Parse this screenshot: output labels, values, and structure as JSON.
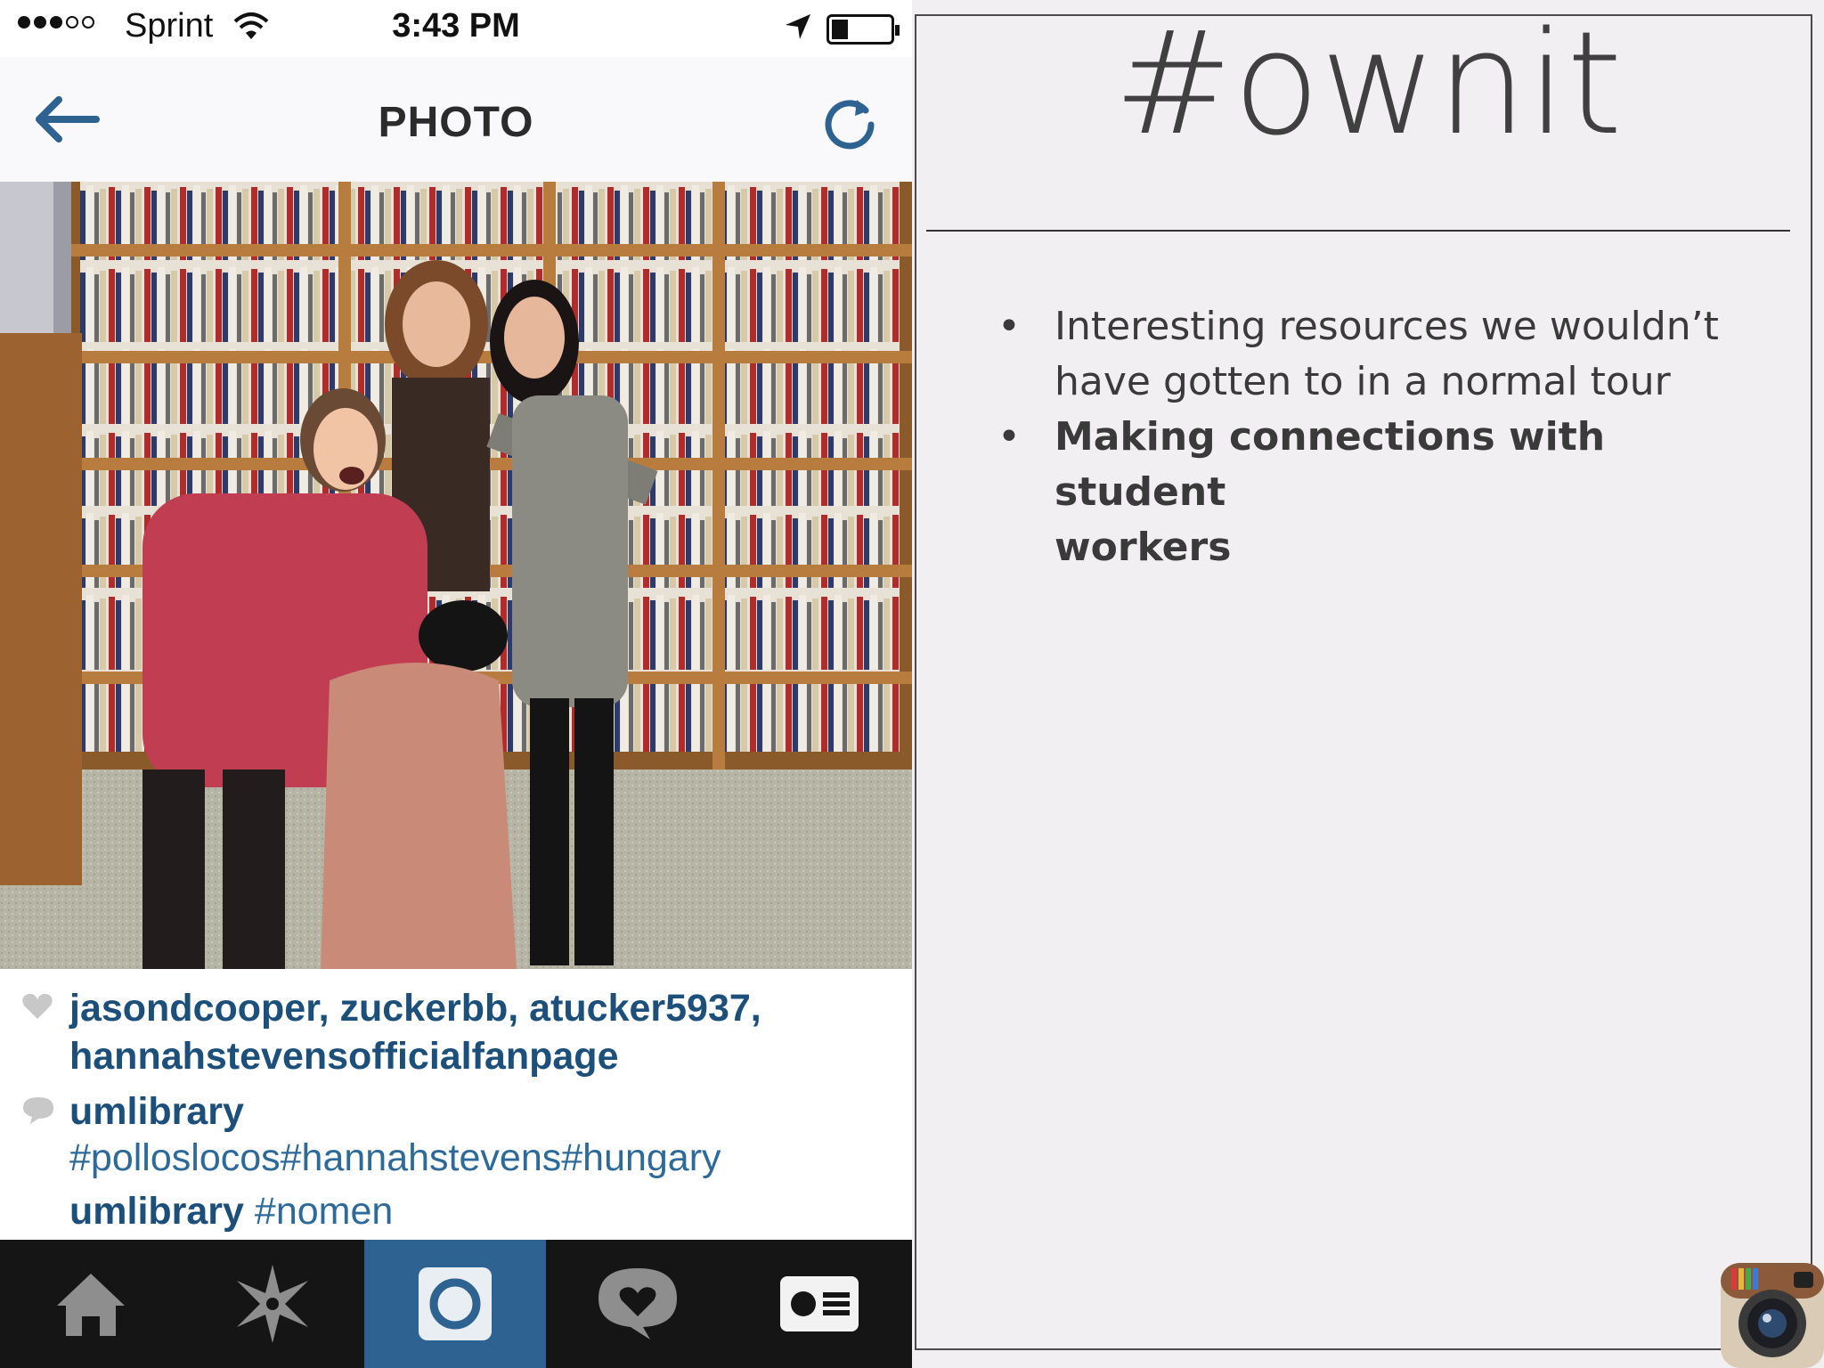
{
  "status_bar": {
    "carrier": "Sprint",
    "time": "3:43 PM"
  },
  "nav": {
    "title": "PHOTO",
    "back_icon": "arrow-left-icon",
    "refresh_icon": "refresh-icon"
  },
  "photo": {
    "alt": "Four students posing in front of library bookshelves"
  },
  "caption": {
    "likes": [
      "jasondcooper,",
      "zuckerbb,",
      "atucker5937,",
      "hannahstevensofficialfanpage"
    ],
    "comments": [
      {
        "user": "umlibrary",
        "text": "#polloslocos#hannahstevens#hungary"
      },
      {
        "user": "umlibrary",
        "text": "#nomen"
      }
    ]
  },
  "tab_bar": {
    "tabs": [
      "home-icon",
      "explore-icon",
      "camera-icon",
      "activity-icon",
      "profile-icon"
    ],
    "active_index": 2
  },
  "slide": {
    "title": "#ownit",
    "bullets": [
      {
        "line1": "Interesting resources we wouldn’t",
        "line2": "have gotten to in a normal tour",
        "bold": false
      },
      {
        "line1": "Making connections with student",
        "line2": "workers",
        "bold": true
      }
    ]
  },
  "colors": {
    "link_blue": "#1c4f7a",
    "tab_active": "#2e6291",
    "tab_bar": "#151515",
    "slide_bg": "#f1eff1"
  }
}
